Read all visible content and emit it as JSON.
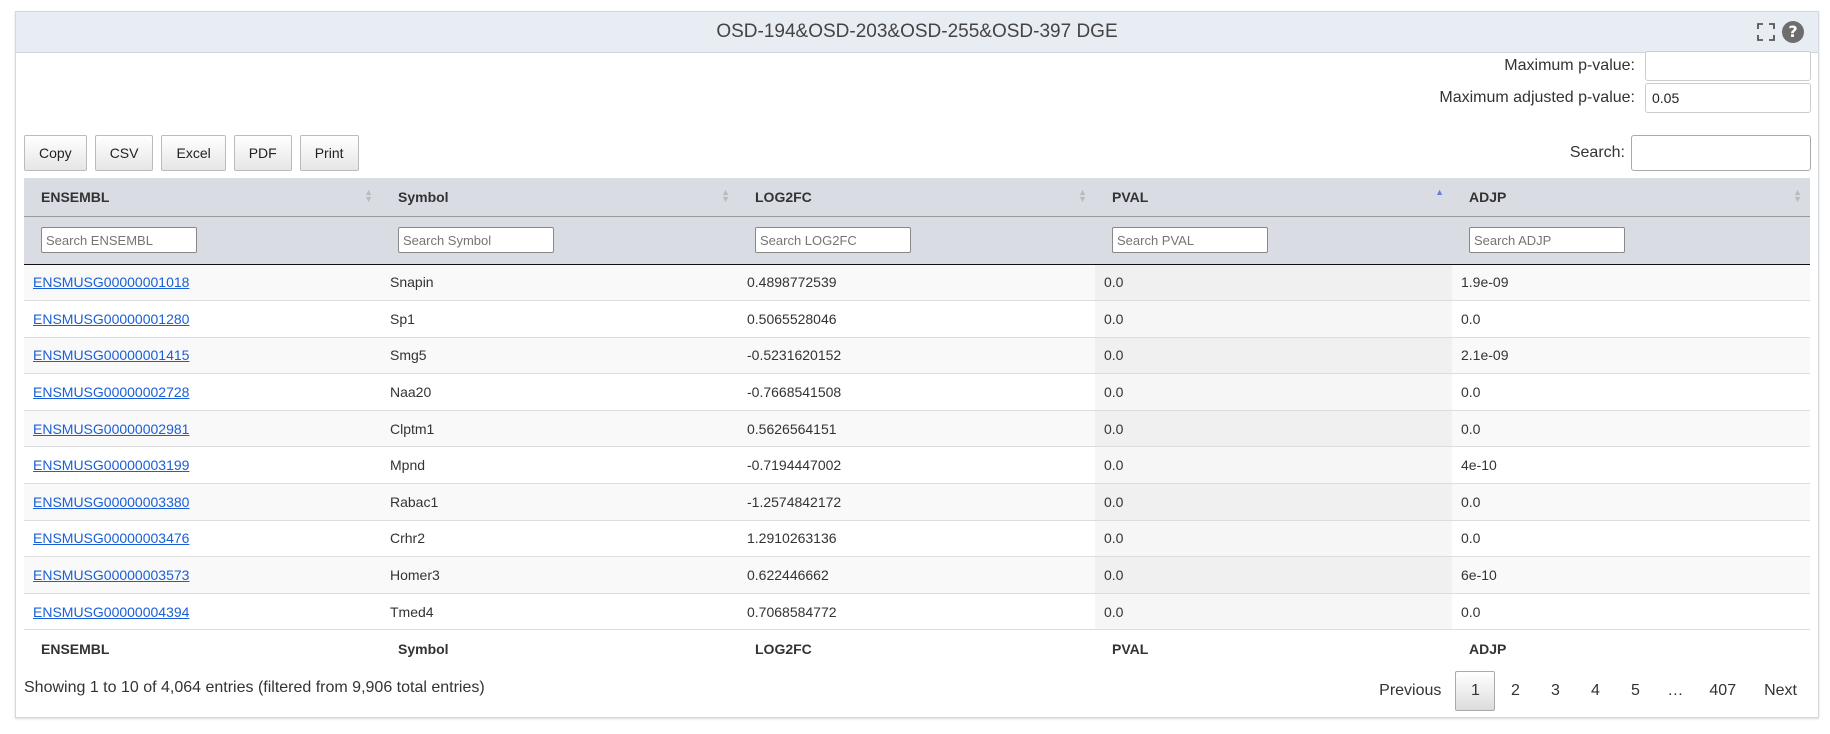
{
  "panel": {
    "title": "OSD-194&OSD-203&OSD-255&OSD-397 DGE"
  },
  "filters": {
    "max_pvalue_label": "Maximum p-value:",
    "max_pvalue_value": "",
    "max_adjp_label": "Maximum adjusted p-value:",
    "max_adjp_value": "0.05"
  },
  "buttons": {
    "copy": "Copy",
    "csv": "CSV",
    "excel": "Excel",
    "pdf": "PDF",
    "print": "Print"
  },
  "search": {
    "label": "Search:",
    "value": ""
  },
  "table": {
    "columns": [
      "ENSEMBL",
      "Symbol",
      "LOG2FC",
      "PVAL",
      "ADJP"
    ],
    "column_search_placeholders": [
      "Search ENSEMBL",
      "Search Symbol",
      "Search LOG2FC",
      "Search PVAL",
      "Search ADJP"
    ],
    "sorted_column": "PVAL",
    "sort_direction": "ascending",
    "rows": [
      [
        "ENSMUSG00000001018",
        "Snapin",
        "0.4898772539",
        "0.0",
        "1.9e-09"
      ],
      [
        "ENSMUSG00000001280",
        "Sp1",
        "0.5065528046",
        "0.0",
        "0.0"
      ],
      [
        "ENSMUSG00000001415",
        "Smg5",
        "-0.5231620152",
        "0.0",
        "2.1e-09"
      ],
      [
        "ENSMUSG00000002728",
        "Naa20",
        "-0.7668541508",
        "0.0",
        "0.0"
      ],
      [
        "ENSMUSG00000002981",
        "Clptm1",
        "0.5626564151",
        "0.0",
        "0.0"
      ],
      [
        "ENSMUSG00000003199",
        "Mpnd",
        "-0.7194447002",
        "0.0",
        "4e-10"
      ],
      [
        "ENSMUSG00000003380",
        "Rabac1",
        "-1.2574842172",
        "0.0",
        "0.0"
      ],
      [
        "ENSMUSG00000003476",
        "Crhr2",
        "1.2910263136",
        "0.0",
        "0.0"
      ],
      [
        "ENSMUSG00000003573",
        "Homer3",
        "0.622446662",
        "0.0",
        "6e-10"
      ],
      [
        "ENSMUSG00000004394",
        "Tmed4",
        "0.7068584772",
        "0.0",
        "0.0"
      ]
    ]
  },
  "info": "Showing 1 to 10 of 4,064 entries (filtered from 9,906 total entries)",
  "pagination": {
    "previous": "Previous",
    "pages": [
      "1",
      "2",
      "3",
      "4",
      "5",
      "…",
      "407"
    ],
    "current": "1",
    "next": "Next"
  }
}
